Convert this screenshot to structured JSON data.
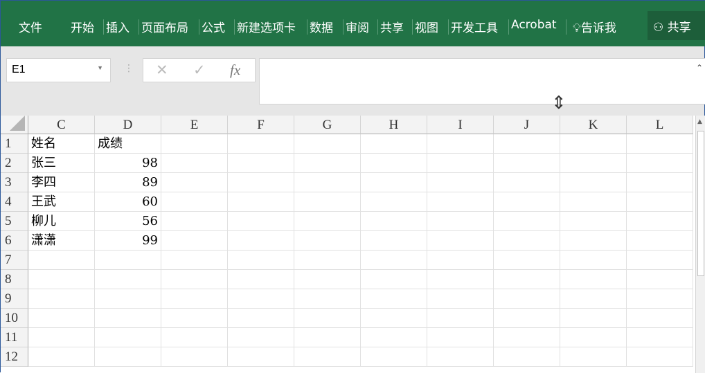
{
  "ribbon": {
    "tabs": [
      "文件",
      "开始",
      "插入",
      "页面布局",
      "公式",
      "新建选项卡",
      "数据",
      "审阅",
      "共享",
      "视图",
      "开发工具",
      "Acrobat"
    ],
    "tell_me": "告诉我",
    "share": "共享"
  },
  "formula_bar": {
    "name_box": "E1",
    "cancel": "✕",
    "enter": "✓",
    "fx": "fx",
    "value": ""
  },
  "sheet": {
    "columns": [
      "C",
      "D",
      "E",
      "F",
      "G",
      "H",
      "I",
      "J",
      "K",
      "L"
    ],
    "rows": [
      "1",
      "2",
      "3",
      "4",
      "5",
      "6",
      "7",
      "8",
      "9",
      "10",
      "11",
      "12"
    ],
    "data": [
      [
        "姓名",
        "成绩"
      ],
      [
        "张三",
        "98"
      ],
      [
        "李四",
        "89"
      ],
      [
        "王武",
        "60"
      ],
      [
        "柳儿",
        "56"
      ],
      [
        "潇潇",
        "99"
      ]
    ]
  }
}
